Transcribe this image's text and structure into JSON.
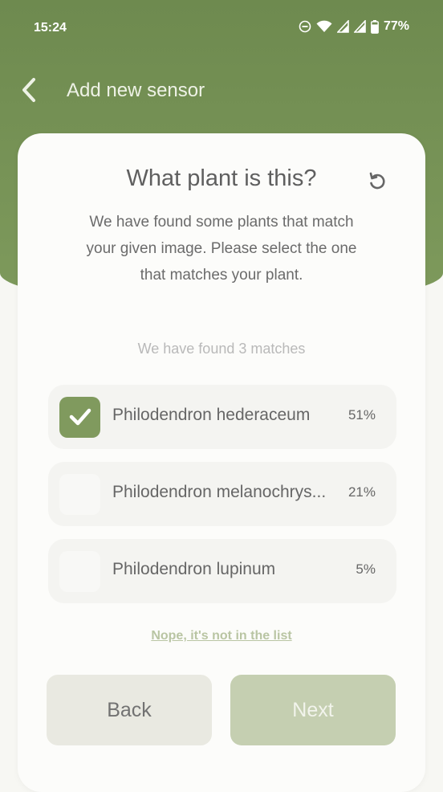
{
  "status_bar": {
    "time": "15:24",
    "battery": "77%",
    "icons": [
      "do-not-disturb-icon",
      "wifi-icon",
      "signal-icon",
      "signal-icon",
      "battery-icon"
    ]
  },
  "appbar": {
    "title": "Add new sensor",
    "back_icon": "chevron-left-icon"
  },
  "card": {
    "title": "What plant is this?",
    "description": "We have found some plants that match your given image. Please select the one that matches your plant.",
    "found_text": "We have found 3 matches",
    "refresh_icon": "refresh-icon",
    "matches": [
      {
        "name": "Philodendron hederaceum",
        "percent": "51%",
        "selected": true
      },
      {
        "name": "Philodendron melanochrys...",
        "percent": "21%",
        "selected": false
      },
      {
        "name": "Philodendron lupinum",
        "percent": "5%",
        "selected": false
      }
    ],
    "not_in_list": "Nope, it's not in the list",
    "back_label": "Back",
    "next_label": "Next"
  },
  "colors": {
    "header_green": "#7E9A5C",
    "accent_green": "#809A5E",
    "next_disabled": "#C5CFB1",
    "back_bg": "#E9E9E1"
  }
}
